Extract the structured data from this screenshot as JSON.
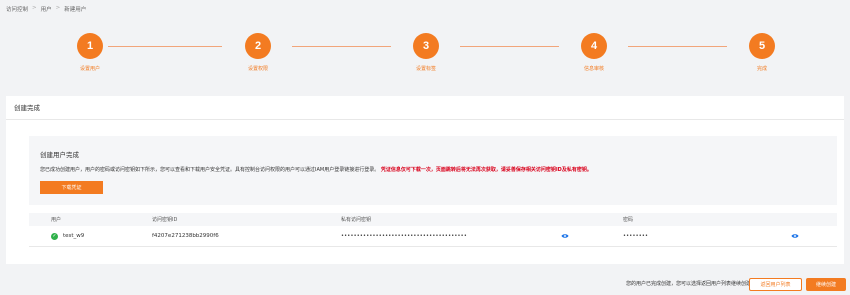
{
  "breadcrumb": [
    "访问控制",
    "用户",
    "新建用户"
  ],
  "steps": [
    {
      "num": "1",
      "label": "设置用户"
    },
    {
      "num": "2",
      "label": "设置权限"
    },
    {
      "num": "3",
      "label": "设置标签"
    },
    {
      "num": "4",
      "label": "信息审核"
    },
    {
      "num": "5",
      "label": "完成"
    }
  ],
  "card": {
    "title": "创建完成",
    "box_title": "创建用户完成",
    "desc": "您已成功创建用户，用户的密码或访问密钥如下所示，您可以查看和下载用户安全凭证。具有控制台访问权限的用户可以通过IAM用户登录链接进行登录。",
    "warning": "凭证信息仅可下载一次，页面跳转后将无法再次获取，请妥善保存相关访问密钥ID及私有密钥。",
    "download_btn": "下载凭证"
  },
  "table": {
    "headers": [
      "用户",
      "访问密钥ID",
      "私有访问密钥",
      "密码"
    ],
    "row": {
      "user": "test_w9",
      "key_id": "f4207e271238bb2990f6",
      "secret": "••••••••••••••••••••••••••••••••••••••••",
      "password": "••••••••"
    }
  },
  "footer": {
    "note": "您的用户已完成创建，您可以选择返回用户列表继续创建。",
    "back_btn": "返回用户列表",
    "continue_btn": "继续创建"
  },
  "colors": {
    "accent": "#f37b21",
    "success": "#2fb14a",
    "warning": "#d9001b",
    "link": "#1a73e8"
  }
}
